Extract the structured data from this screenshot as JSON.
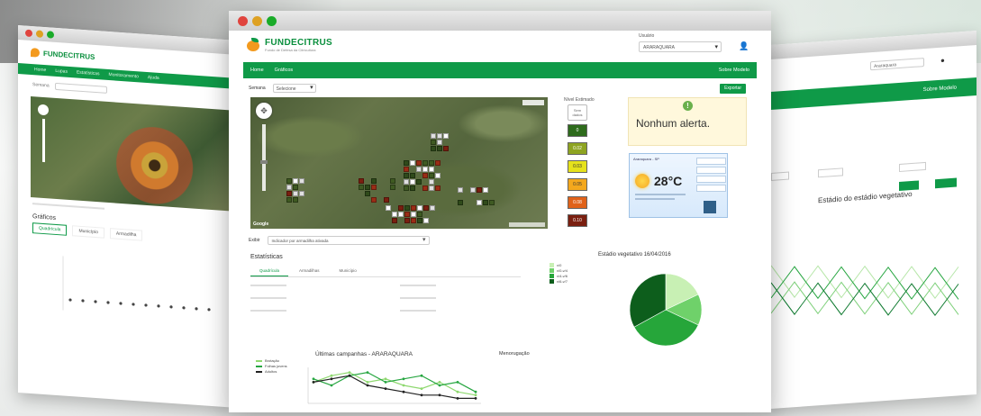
{
  "main": {
    "logo_name": "FUNDECITRUS",
    "logo_tagline": "Fundo de Defesa da Citricultura",
    "user_label": "Usuário",
    "user_value": "ARARAQUARA",
    "nav": [
      "Home",
      "Gráficos"
    ],
    "nav_right": "Sobre Modelo",
    "toolbar": {
      "label": "Semana",
      "select_value": "Selecione",
      "export_label": "Exportar"
    },
    "map": {
      "credit": "Google"
    },
    "legend": {
      "title": "Nível Estimado",
      "none_label": "Sem dados",
      "levels": [
        {
          "label": "0",
          "color": "#2e6b1c"
        },
        {
          "label": "0.02",
          "color": "#8ea421"
        },
        {
          "label": "0.03",
          "color": "#e6e21c"
        },
        {
          "label": "0.05",
          "color": "#f4a81d"
        },
        {
          "label": "0.08",
          "color": "#e0621a"
        },
        {
          "label": "0.10",
          "color": "#7a1f10"
        }
      ]
    },
    "alert": {
      "text": "Nonhum alerta."
    },
    "weather": {
      "temperature": "28°C",
      "location": "Araraquara - SP"
    },
    "layer": {
      "label": "Exibir",
      "select_value": "Indicador por armadilha ativada"
    },
    "statistics": {
      "title": "Estatísticas",
      "tabs": [
        "Quadrícula",
        "Armadilhas",
        "Município"
      ]
    },
    "vegetative": {
      "title": "Estádio vegetativo 16/04/2016",
      "legend": [
        {
          "label": "v/0",
          "color": "#c8f0b4"
        },
        {
          "label": "v/0-v/4",
          "color": "#6fd16a"
        },
        {
          "label": "v/4-v/6",
          "color": "#26a63a"
        },
        {
          "label": "v/6-v/7",
          "color": "#0d5e1c"
        }
      ],
      "chart_data": {
        "type": "pie",
        "categories": [
          "v/0",
          "v/0-v/4",
          "v/4-v/6",
          "v/6-v/7"
        ],
        "values": [
          18,
          14,
          35,
          33
        ]
      }
    },
    "line_chart": {
      "title": "Últimas campanhas - ARARAQUARA",
      "side_title": "Menorugação",
      "legend": [
        {
          "label": "Brotação",
          "color": "#8ed86f"
        },
        {
          "label": "Folhas jovens",
          "color": "#27a641"
        },
        {
          "label": "Adultos",
          "color": "#222222"
        }
      ],
      "chart_data": {
        "type": "line",
        "series": [
          {
            "name": "Brotação",
            "values": [
              6,
              8,
              9,
              6,
              7,
              5,
              4,
              6,
              3,
              2
            ]
          },
          {
            "name": "Folhas jovens",
            "values": [
              7,
              5,
              8,
              9,
              6,
              7,
              8,
              5,
              6,
              3
            ]
          },
          {
            "name": "Adultos",
            "values": [
              6,
              7,
              8,
              5,
              4,
              3,
              2,
              2,
              1,
              1
            ]
          }
        ]
      }
    }
  },
  "left": {
    "nav": [
      "Home",
      "Lupas",
      "Estatísticas",
      "Monitoramento",
      "Ajuda"
    ],
    "filter_label": "Semana",
    "stats_title": "Gráficos",
    "tabs": [
      "Quadrícula",
      "Município",
      "Armadilha"
    ]
  },
  "right": {
    "user_value": "Araraquara",
    "nav_right": "Sobre Modelo",
    "chart_title": "Estádio do estádio vegetativo"
  }
}
